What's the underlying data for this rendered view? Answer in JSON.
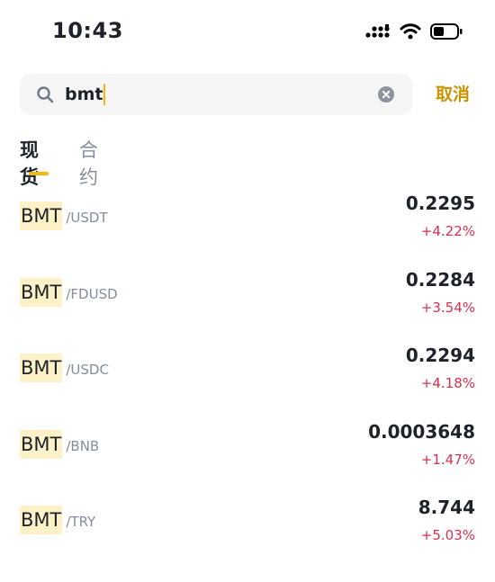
{
  "status": {
    "time": "10:43"
  },
  "search": {
    "query": "bmt",
    "cancel_label": "取消"
  },
  "tabs": [
    {
      "label": "现货"
    },
    {
      "label": "合约"
    }
  ],
  "markets": [
    {
      "base": "BMT",
      "quote": "/USDT",
      "price": "0.2295",
      "change": "+4.22%"
    },
    {
      "base": "BMT",
      "quote": "/FDUSD",
      "price": "0.2284",
      "change": "+3.54%"
    },
    {
      "base": "BMT",
      "quote": "/USDC",
      "price": "0.2294",
      "change": "+4.18%"
    },
    {
      "base": "BMT",
      "quote": "/BNB",
      "price": "0.0003648",
      "change": "+1.47%"
    },
    {
      "base": "BMT",
      "quote": "/TRY",
      "price": "8.744",
      "change": "+5.03%"
    }
  ],
  "colors": {
    "accent": "#f0b90b",
    "cancel": "#c99400",
    "positive": "#d9304e",
    "highlight": "#fdf1c8"
  }
}
